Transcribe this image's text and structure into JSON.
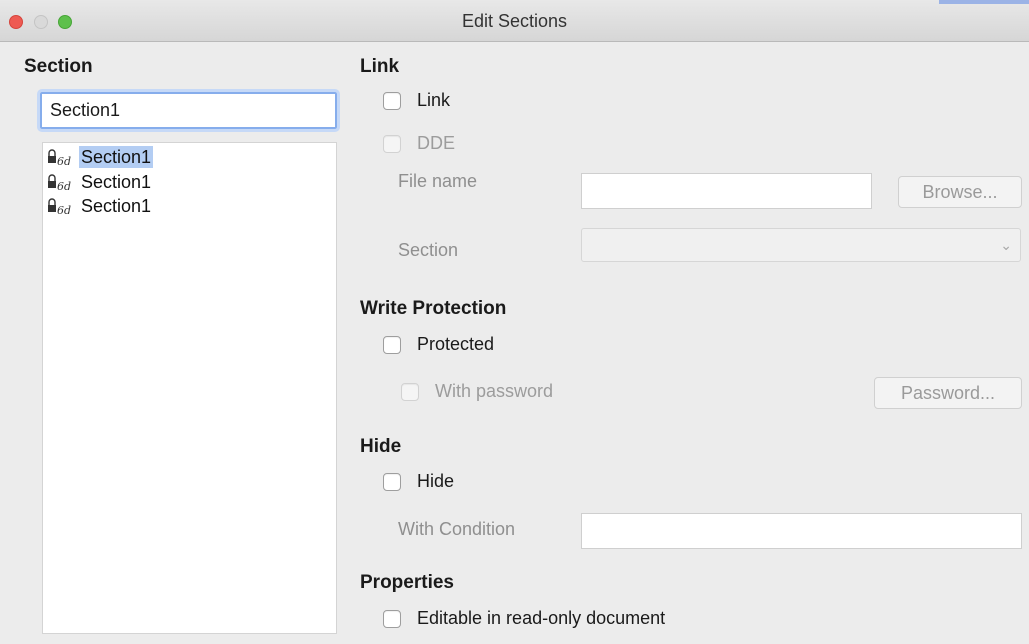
{
  "window": {
    "title": "Edit Sections"
  },
  "section_panel": {
    "heading": "Section",
    "name_value": "Section1",
    "tree_items": [
      {
        "label": "Section1",
        "selected": true
      },
      {
        "label": "Section1",
        "selected": false
      },
      {
        "label": "Section1",
        "selected": false
      }
    ]
  },
  "link": {
    "heading": "Link",
    "link_checkbox": "Link",
    "dde_checkbox": "DDE",
    "file_name_label": "File name",
    "file_name_value": "",
    "browse_button": "Browse...",
    "section_label": "Section",
    "section_value": ""
  },
  "write_protection": {
    "heading": "Write Protection",
    "protected_checkbox": "Protected",
    "with_password_checkbox": "With password",
    "password_button": "Password..."
  },
  "hide": {
    "heading": "Hide",
    "hide_checkbox": "Hide",
    "condition_label": "With Condition",
    "condition_value": ""
  },
  "properties": {
    "heading": "Properties",
    "editable_checkbox": "Editable in read-only document"
  },
  "colors": {
    "selection": "#b3cdf3",
    "focus_ring": "#86adec",
    "close": "#ee5a52",
    "maximize": "#5ec04c"
  }
}
